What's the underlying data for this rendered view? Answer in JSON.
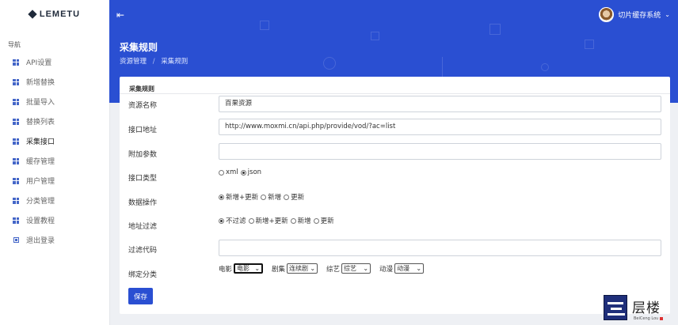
{
  "brand": {
    "name": "LEMETU"
  },
  "sidebar": {
    "heading": "导航",
    "items": [
      {
        "label": "API设置",
        "icon": "grid-icon"
      },
      {
        "label": "新增替换",
        "icon": "grid-icon"
      },
      {
        "label": "批量导入",
        "icon": "grid-icon"
      },
      {
        "label": "替换列表",
        "icon": "grid-icon"
      },
      {
        "label": "采集接口",
        "icon": "grid-icon",
        "active": true
      },
      {
        "label": "缓存管理",
        "icon": "grid-icon"
      },
      {
        "label": "用户管理",
        "icon": "grid-icon"
      },
      {
        "label": "分类管理",
        "icon": "grid-icon"
      },
      {
        "label": "设置教程",
        "icon": "grid-icon"
      },
      {
        "label": "退出登录",
        "icon": "logout-icon"
      }
    ]
  },
  "header": {
    "menu_icon": "sidebar-toggle-icon",
    "user_name": "切片缓存系统",
    "page_title": "采集规则",
    "breadcrumb": [
      "资源管理",
      "采集规则"
    ],
    "breadcrumb_sep": "/",
    "accent": "#2a4fd2"
  },
  "form": {
    "title": "采集规则",
    "name": {
      "label": "资源名称",
      "value": "百果资源"
    },
    "api": {
      "label": "接口地址",
      "value": "http://www.moxmi.cn/api.php/provide/vod/?ac=list"
    },
    "params": {
      "label": "附加参数",
      "value": ""
    },
    "type": {
      "label": "接口类型",
      "options": [
        "xml",
        "json"
      ],
      "selected": "json"
    },
    "data_op": {
      "label": "数据操作",
      "options": [
        "新增+更新",
        "新增",
        "更新"
      ],
      "selected": "新增+更新"
    },
    "filter": {
      "label": "地址过滤",
      "options": [
        "不过滤",
        "新增+更新",
        "新增",
        "更新"
      ],
      "selected": "不过滤"
    },
    "filter_code": {
      "label": "过滤代码",
      "value": ""
    },
    "bind": {
      "label": "绑定分类",
      "selects": [
        {
          "label": "电影",
          "value": "电影"
        },
        {
          "label": "剧集",
          "value": "连续剧"
        },
        {
          "label": "综艺",
          "value": "综艺"
        },
        {
          "label": "动漫",
          "value": "动漫"
        }
      ]
    },
    "save_label": "保存"
  },
  "watermark": {
    "text": "层楼",
    "sub": "BeiCeng Lou"
  }
}
